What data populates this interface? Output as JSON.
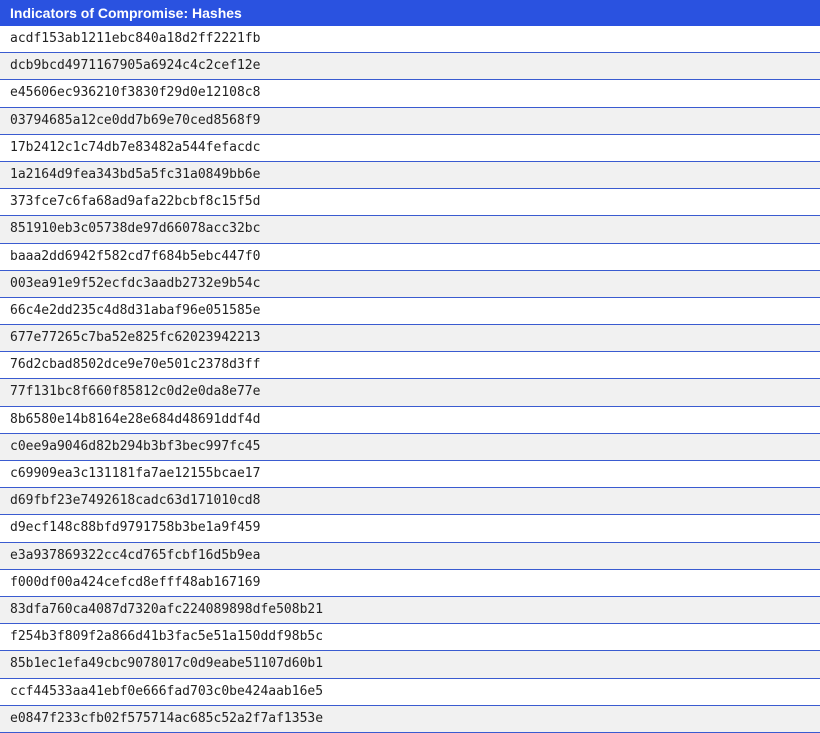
{
  "header": {
    "title": "Indicators of Compromise: Hashes"
  },
  "hashes": [
    "acdf153ab1211ebc840a18d2ff2221fb",
    "dcb9bcd4971167905a6924c4c2cef12e",
    "e45606ec936210f3830f29d0e12108c8",
    "03794685a12ce0dd7b69e70ced8568f9",
    "17b2412c1c74db7e83482a544fefacdc",
    "1a2164d9fea343bd5a5fc31a0849bb6e",
    "373fce7c6fa68ad9afa22bcbf8c15f5d",
    "851910eb3c05738de97d66078acc32bc",
    "baaa2dd6942f582cd7f684b5ebc447f0",
    "003ea91e9f52ecfdc3aadb2732e9b54c",
    "66c4e2dd235c4d8d31abaf96e051585e",
    "677e77265c7ba52e825fc62023942213",
    "76d2cbad8502dce9e70e501c2378d3ff",
    "77f131bc8f660f85812c0d2e0da8e77e",
    "8b6580e14b8164e28e684d48691ddf4d",
    "c0ee9a9046d82b294b3bf3bec997fc45",
    "c69909ea3c131181fa7ae12155bcae17",
    "d69fbf23e7492618cadc63d171010cd8",
    "d9ecf148c88bfd9791758b3be1a9f459",
    "e3a937869322cc4cd765fcbf16d5b9ea",
    "f000df00a424cefcd8efff48ab167169",
    "83dfa760ca4087d7320afc224089898dfe508b21",
    "f254b3f809f2a866d41b3fac5e51a150ddf98b5c",
    "85b1ec1efa49cbc9078017c0d9eabe51107d60b1",
    "ccf44533aa41ebf0e666fad703c0be424aab16e5",
    "e0847f233cfb02f575714ac685c52a2f7af1353e"
  ],
  "colors": {
    "header_bg": "#2a52e0",
    "row_alt_bg": "#f1f1f1",
    "row_border": "#3a5bd0"
  }
}
